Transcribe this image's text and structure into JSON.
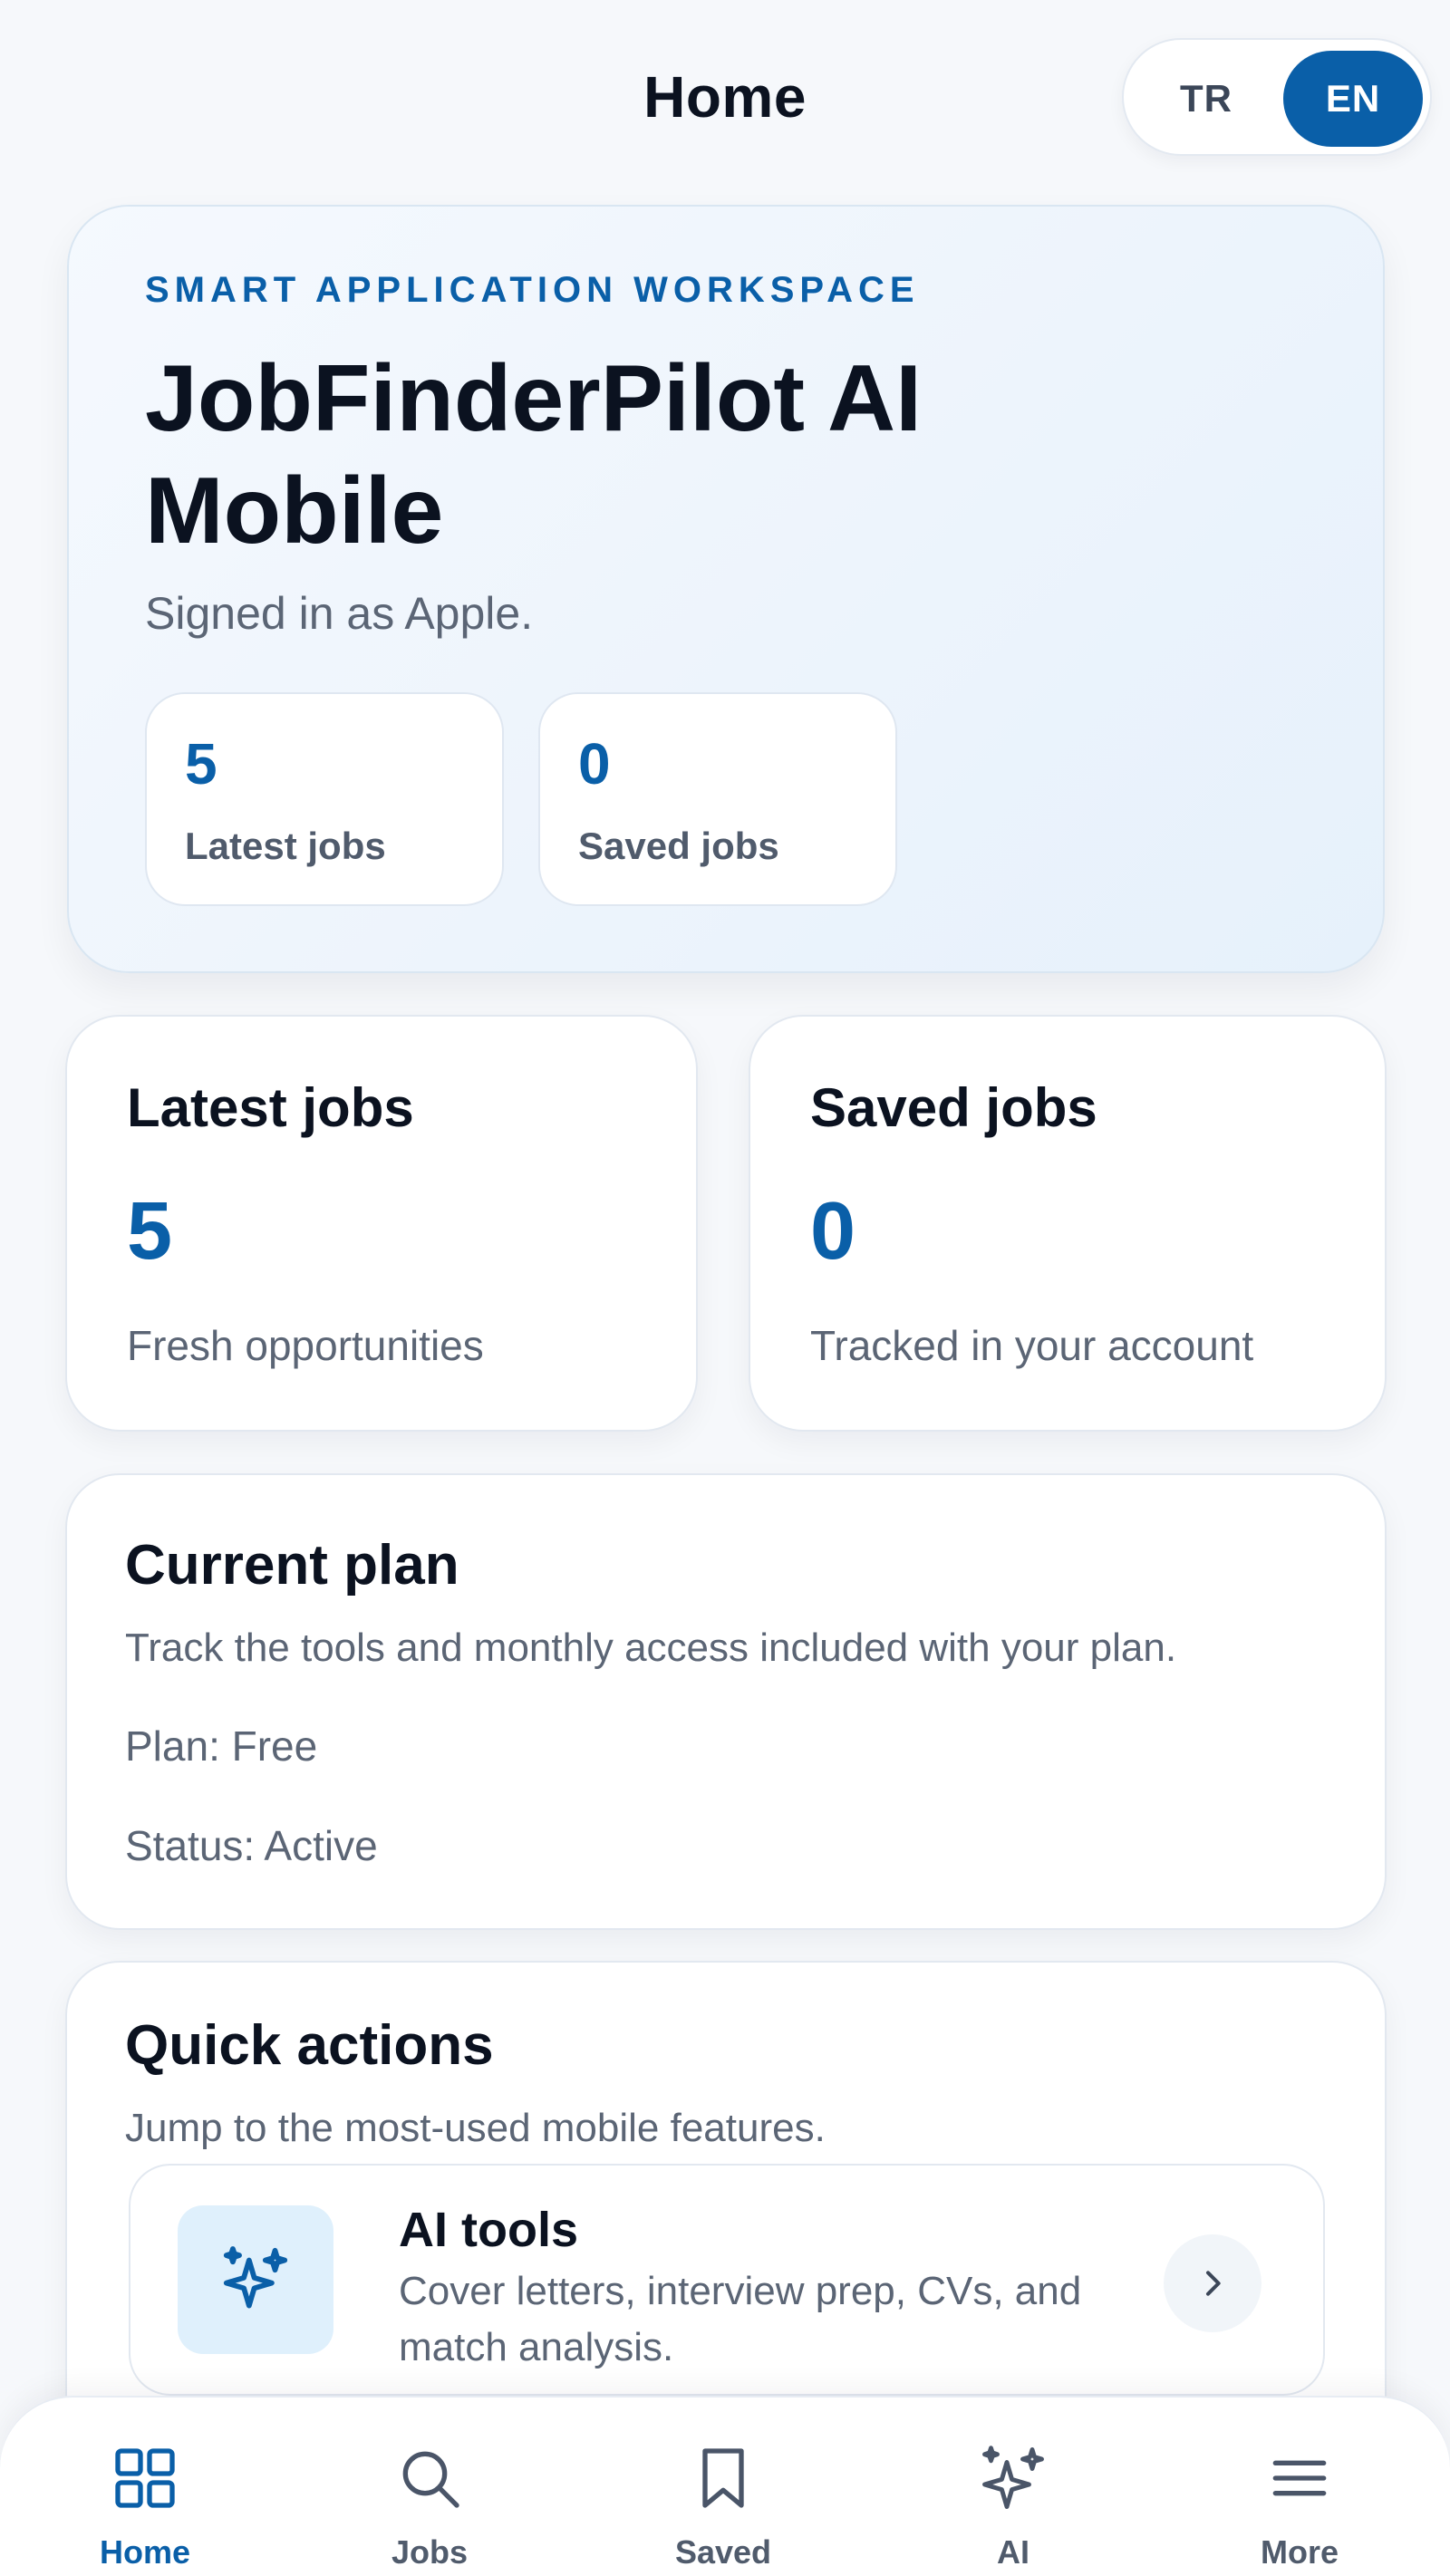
{
  "header": {
    "title": "Home",
    "languages": [
      {
        "code": "TR",
        "selected": false
      },
      {
        "code": "EN",
        "selected": true
      }
    ]
  },
  "hero": {
    "eyebrow": "SMART APPLICATION WORKSPACE",
    "title": "JobFinderPilot AI Mobile",
    "subtitle": "Signed in as Apple.",
    "stats": [
      {
        "value": "5",
        "label": "Latest jobs"
      },
      {
        "value": "0",
        "label": "Saved jobs"
      }
    ]
  },
  "stat_cards": [
    {
      "title": "Latest jobs",
      "value": "5",
      "description": "Fresh opportunities"
    },
    {
      "title": "Saved jobs",
      "value": "0",
      "description": "Tracked in your account"
    }
  ],
  "plan": {
    "title": "Current plan",
    "description": "Track the tools and monthly access included with your plan.",
    "plan_line": "Plan: Free",
    "status_line": "Status: Active"
  },
  "quick_actions": {
    "title": "Quick actions",
    "description": "Jump to the most-used mobile features.",
    "items": [
      {
        "title": "AI tools",
        "description": "Cover letters, interview prep, CVs, and match analysis.",
        "icon": "sparkles-icon"
      }
    ]
  },
  "nav": {
    "items": [
      {
        "label": "Home",
        "icon": "grid-icon",
        "active": true
      },
      {
        "label": "Jobs",
        "icon": "search-icon",
        "active": false
      },
      {
        "label": "Saved",
        "icon": "bookmark-icon",
        "active": false
      },
      {
        "label": "AI",
        "icon": "sparkles-icon",
        "active": false
      },
      {
        "label": "More",
        "icon": "menu-icon",
        "active": false
      }
    ]
  },
  "colors": {
    "accent": "#0a5fa8",
    "text_primary": "#0b1220",
    "text_secondary": "#5b6575",
    "background": "#f6f8fb",
    "icon_tile": "#dff0fc"
  }
}
